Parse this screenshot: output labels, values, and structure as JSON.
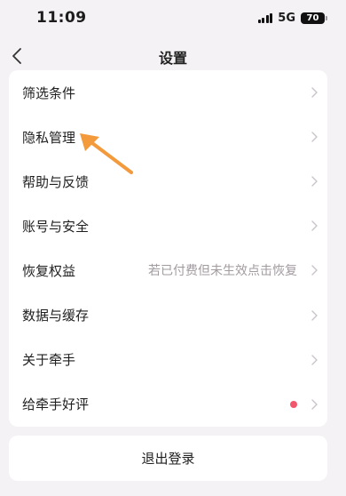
{
  "status_bar": {
    "time": "11:09",
    "network": "5G",
    "battery": "70"
  },
  "header": {
    "title": "设置"
  },
  "settings": {
    "items": [
      {
        "label": "筛选条件"
      },
      {
        "label": "隐私管理"
      },
      {
        "label": "帮助与反馈"
      },
      {
        "label": "账号与安全"
      },
      {
        "label": "恢复权益",
        "hint": "若已付费但未生效点击恢复"
      },
      {
        "label": "数据与缓存"
      },
      {
        "label": "关于牵手"
      },
      {
        "label": "给牵手好评",
        "badge": "red-dot"
      }
    ]
  },
  "logout": {
    "label": "退出登录"
  },
  "colors": {
    "background": "#f4f2f4",
    "card": "#ffffff",
    "hint_text": "#a29ba0",
    "badge_dot": "#f2566b",
    "annotation_arrow": "#f39a3c"
  },
  "icons": {
    "back": "chevron-left-icon",
    "row": "chevron-right-icon",
    "pointer": "arrow-annotation-icon"
  }
}
